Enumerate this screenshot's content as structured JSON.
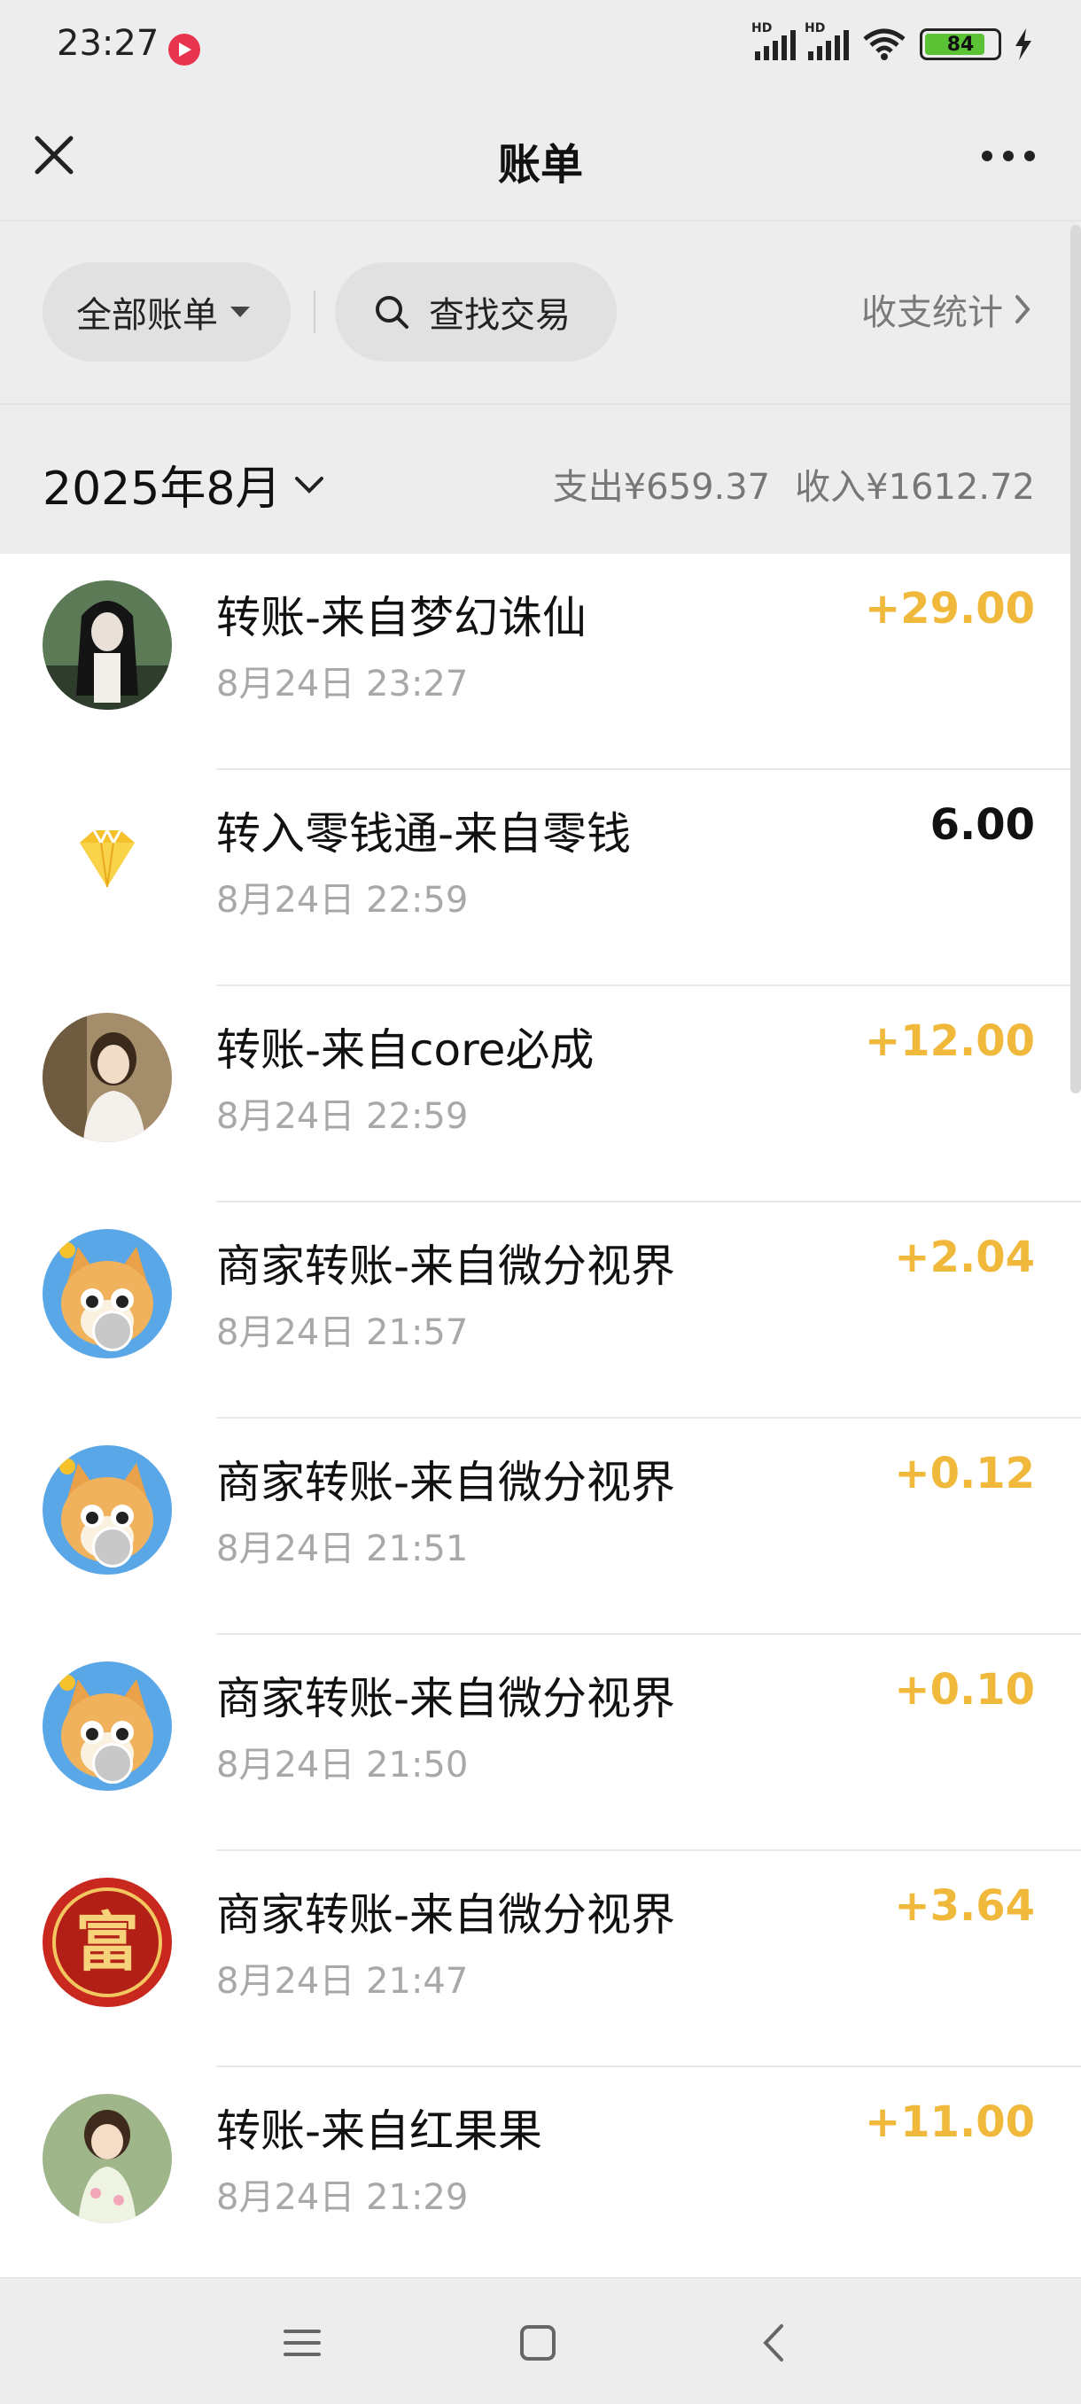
{
  "status_bar": {
    "time": "23:27",
    "battery": "84",
    "hd1": "HD",
    "hd2": "HD"
  },
  "header": {
    "title": "账单"
  },
  "filters": {
    "all_label": "全部账单",
    "search_label": "查找交易",
    "stats_label": "收支统计"
  },
  "month_bar": {
    "month": "2025年8月",
    "expense": "支出¥659.37",
    "income": "收入¥1612.72"
  },
  "transactions": [
    {
      "title": "转账-来自梦幻诛仙",
      "time": "8月24日 23:27",
      "amount": "+29.00"
    },
    {
      "title": "转入零钱通-来自零钱",
      "time": "8月24日 22:59",
      "amount": "6.00"
    },
    {
      "title": "转账-来自core必成",
      "time": "8月24日 22:59",
      "amount": "+12.00"
    },
    {
      "title": "商家转账-来自微分视界",
      "time": "8月24日 21:57",
      "amount": "+2.04"
    },
    {
      "title": "商家转账-来自微分视界",
      "time": "8月24日 21:51",
      "amount": "+0.12"
    },
    {
      "title": "商家转账-来自微分视界",
      "time": "8月24日 21:50",
      "amount": "+0.10"
    },
    {
      "title": "商家转账-来自微分视界",
      "time": "8月24日 21:47",
      "amount": "+3.64"
    },
    {
      "title": "转账-来自红果果",
      "time": "8月24日 21:29",
      "amount": "+11.00"
    }
  ],
  "avatar_text": {
    "fu": "富"
  },
  "colors": {
    "income": "#f0b93c",
    "background": "#ededed",
    "gold": "#f6c22c"
  }
}
